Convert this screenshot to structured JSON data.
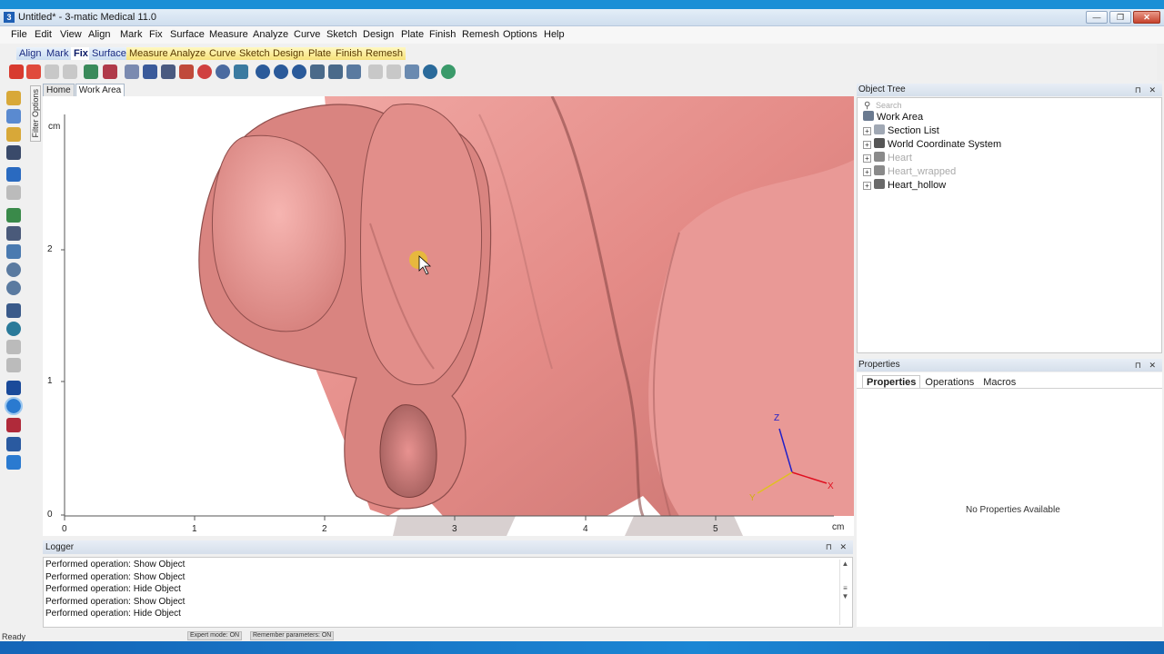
{
  "window": {
    "title": "Untitled* - 3-matic Medical 11.0",
    "controls": [
      "—",
      "❐",
      "✕"
    ]
  },
  "menu": [
    "File",
    "Edit",
    "View",
    "Align",
    "Mark",
    "Fix",
    "Surface",
    "Measure",
    "Analyze",
    "Curve",
    "Sketch",
    "Design",
    "Plate",
    "Finish",
    "Remesh",
    "Options",
    "Help"
  ],
  "tabs": [
    {
      "label": "Align",
      "style": "blue"
    },
    {
      "label": "Mark",
      "style": "blue"
    },
    {
      "label": "Fix",
      "style": "active"
    },
    {
      "label": "Surface",
      "style": "blue"
    },
    {
      "label": "Measure",
      "style": "yellow"
    },
    {
      "label": "Analyze",
      "style": "yellow"
    },
    {
      "label": "Curve",
      "style": "yellow"
    },
    {
      "label": "Sketch",
      "style": "yellow"
    },
    {
      "label": "Design",
      "style": "yellow"
    },
    {
      "label": "Plate",
      "style": "yellow"
    },
    {
      "label": "Finish",
      "style": "yellow"
    },
    {
      "label": "Remesh",
      "style": "yellow"
    }
  ],
  "left_panel": {
    "filter_options": "Filter Options"
  },
  "view_tabs": [
    {
      "label": "Home",
      "active": false
    },
    {
      "label": "Work Area",
      "active": true
    }
  ],
  "viewport": {
    "y_axis_unit": "cm",
    "x_axis_unit": "cm",
    "y_ticks": [
      "0",
      "1",
      "2"
    ],
    "x_ticks": [
      "0",
      "1",
      "2",
      "3",
      "4",
      "5"
    ],
    "triad": {
      "x": "X",
      "y": "Y",
      "z": "Z"
    },
    "colors": {
      "tissue": "#e8938f",
      "tissue_dark": "#b86b69",
      "tissue_light": "#f3b2ae",
      "axis_x": "#e01020",
      "axis_y": "#e0c020",
      "axis_z": "#2020c8"
    }
  },
  "object_tree": {
    "title": "Object Tree",
    "search_placeholder": "Search",
    "root": "Work Area",
    "items": [
      {
        "label": "Section List",
        "dim": false
      },
      {
        "label": "World Coordinate System",
        "dim": false
      },
      {
        "label": "Heart",
        "dim": true
      },
      {
        "label": "Heart_wrapped",
        "dim": true
      },
      {
        "label": "Heart_hollow",
        "dim": false
      }
    ]
  },
  "properties": {
    "title": "Properties",
    "tabs": [
      "Properties",
      "Operations",
      "Macros"
    ],
    "empty_text": "No Properties Available"
  },
  "logger": {
    "title": "Logger",
    "lines": [
      "Performed operation: Show Object",
      "Performed operation: Show Object",
      "Performed operation: Hide Object",
      "Performed operation: Show Object",
      "Performed operation: Hide Object"
    ]
  },
  "status": {
    "ready": "Ready",
    "expert_mode": "Expert mode: ON",
    "remember_params": "Remember parameters: ON"
  },
  "panel_pins": "⊓ ✕"
}
